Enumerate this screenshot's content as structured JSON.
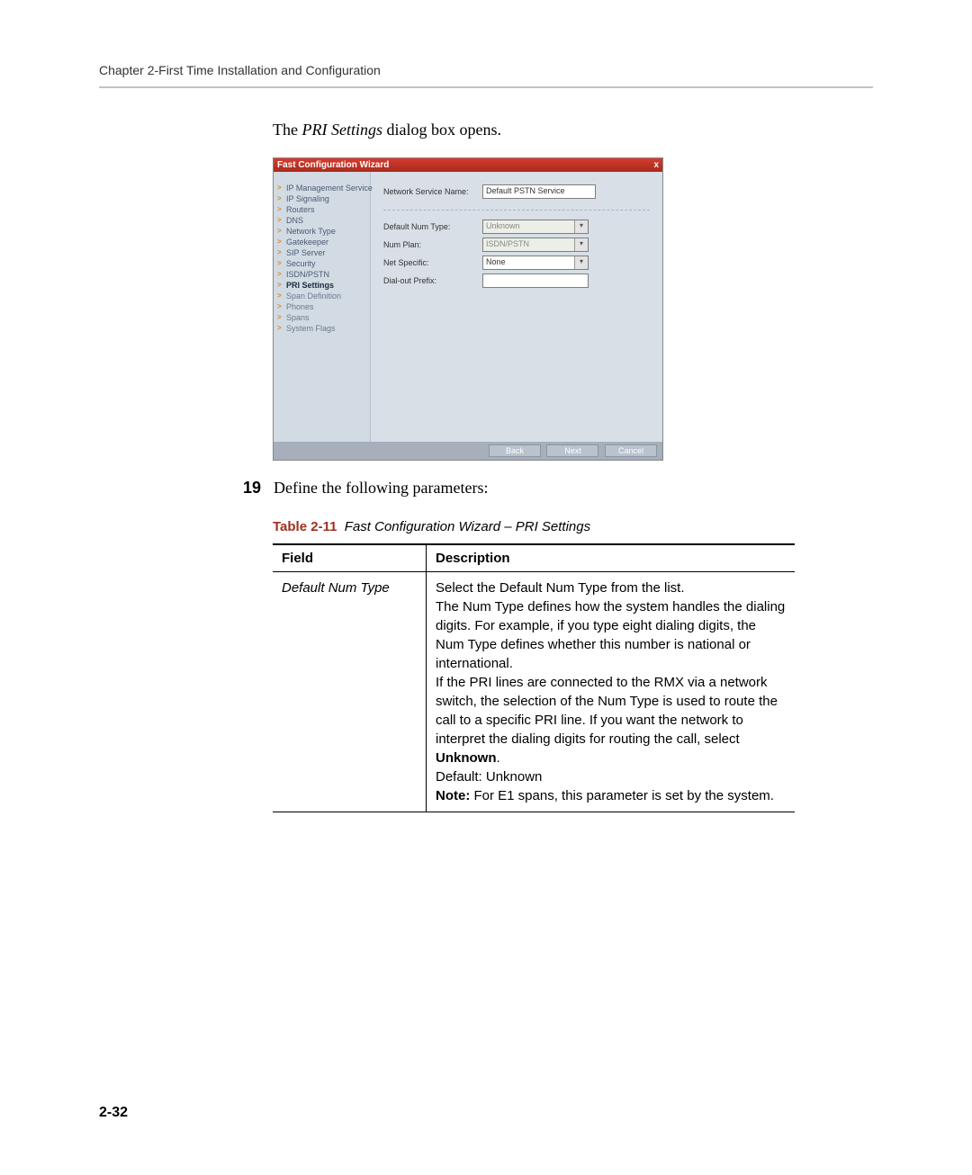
{
  "header": {
    "chapter": "Chapter 2-First Time Installation and Configuration"
  },
  "intro": {
    "pre": "The ",
    "italic": "PRI Settings",
    "post": " dialog box opens."
  },
  "dialog": {
    "title": "Fast Configuration Wizard",
    "close": "x",
    "nav": {
      "items": [
        "IP Management Service",
        "IP Signaling",
        "Routers",
        "DNS",
        "Network Type",
        "Gatekeeper",
        "SIP Server",
        "Security",
        "ISDN/PSTN",
        "PRI Settings",
        "Span Definition",
        "Phones",
        "Spans",
        "System Flags"
      ]
    },
    "form": {
      "serviceNameLabel": "Network Service Name:",
      "serviceNameValue": "Default PSTN Service",
      "defaultNumTypeLabel": "Default Num Type:",
      "defaultNumTypeValue": "Unknown",
      "numPlanLabel": "Num Plan:",
      "numPlanValue": "ISDN/PSTN",
      "netSpecificLabel": "Net Specific:",
      "netSpecificValue": "None",
      "dialOutLabel": "Dial-out Prefix:",
      "dialOutValue": ""
    },
    "buttons": {
      "back": "Back",
      "next": "Next",
      "cancel": "Cancel"
    }
  },
  "step": {
    "num": "19",
    "text": "Define the following parameters:"
  },
  "tableCaption": {
    "num": "Table 2-11",
    "title": "Fast Configuration Wizard – PRI Settings"
  },
  "table": {
    "headers": {
      "field": "Field",
      "desc": "Description"
    },
    "rows": [
      {
        "field": "Default Num Type",
        "desc_p1": "Select the Default Num Type from the list.",
        "desc_p2": "The Num Type defines how the system handles the dialing digits. For example, if you type eight dialing digits, the Num Type defines whether this number is national or international.",
        "desc_p3_pre": "If the PRI lines are connected to the RMX via a network switch, the selection of the Num Type is used to route the call to a specific PRI line. If you want the network to interpret the dialing digits for routing the call, select ",
        "desc_p3_bold": "Unknown",
        "desc_p3_post": ".",
        "desc_p4": "Default: Unknown",
        "desc_p5_bold": "Note:",
        "desc_p5_rest": " For E1 spans, this parameter is set by the system."
      }
    ]
  },
  "pageNum": "2-32"
}
